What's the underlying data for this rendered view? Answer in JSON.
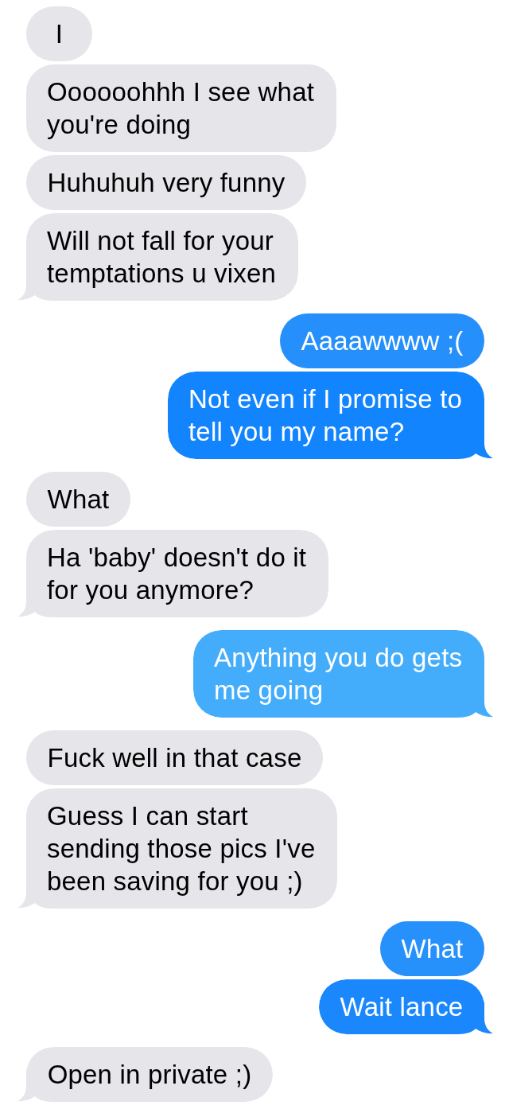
{
  "conversation": [
    {
      "outgoing": false,
      "messages": [
        {
          "text": "I",
          "color": "#e5e5ea"
        },
        {
          "text": "Oooooohhh I see what you're doing",
          "color": "#e5e5ea"
        },
        {
          "text": "Huhuhuh very funny",
          "color": "#e5e5ea"
        },
        {
          "text": "Will not fall for your temptations u vixen",
          "color": "#e5e5ea"
        }
      ]
    },
    {
      "outgoing": true,
      "messages": [
        {
          "text": "Aaaawwww ;(",
          "color": "#258ffb"
        },
        {
          "text": "Not even if I promise to tell you my name?",
          "color": "#1284fe"
        }
      ]
    },
    {
      "outgoing": false,
      "messages": [
        {
          "text": "What",
          "color": "#e5e5ea"
        },
        {
          "text": "Ha 'baby' doesn't do it for you anymore?",
          "color": "#e5e5ea"
        }
      ]
    },
    {
      "outgoing": true,
      "messages": [
        {
          "text": "Anything you do gets me going",
          "color": "#44adfb"
        }
      ]
    },
    {
      "outgoing": false,
      "messages": [
        {
          "text": "Fuck well in that case",
          "color": "#e5e5ea"
        },
        {
          "text": "Guess I can start sending those pics I've been saving for you ;)",
          "color": "#e5e5ea"
        }
      ]
    },
    {
      "outgoing": true,
      "messages": [
        {
          "text": "What",
          "color": "#2690fb"
        },
        {
          "text": "Wait lance",
          "color": "#1a88fc"
        }
      ]
    },
    {
      "outgoing": false,
      "messages": [
        {
          "text": "Open in private ;)",
          "color": "#e5e5ea"
        }
      ]
    }
  ]
}
